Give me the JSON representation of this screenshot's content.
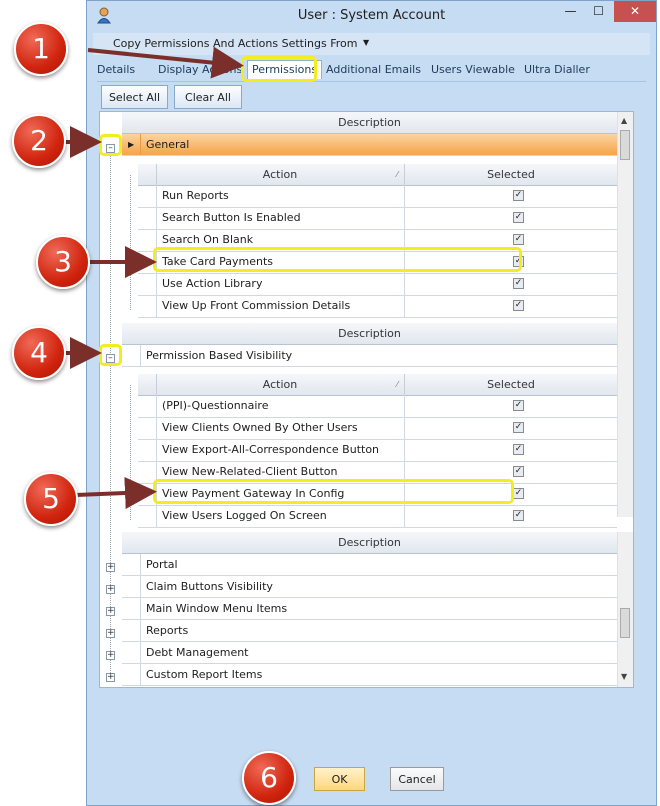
{
  "window": {
    "title": "User : System Account"
  },
  "menu": {
    "copy_settings_label": "Copy Permissions And Actions Settings From"
  },
  "tabs": [
    {
      "label": "Details"
    },
    {
      "label": "Display Actions"
    },
    {
      "label": "Permissions",
      "active": true
    },
    {
      "label": "Additional Emails"
    },
    {
      "label": "Users Viewable"
    },
    {
      "label": "Ultra Dialler"
    }
  ],
  "toolbar": {
    "select_all_label": "Select All",
    "clear_all_label": "Clear All"
  },
  "grid": {
    "column_header": "Description",
    "groups": [
      {
        "label": "General",
        "selected": true,
        "action_header": "Action",
        "selected_header": "Selected",
        "actions": [
          {
            "label": "Run Reports",
            "checked": true
          },
          {
            "label": "Search Button Is Enabled",
            "checked": true
          },
          {
            "label": "Search On Blank",
            "checked": true
          },
          {
            "label": "Take Card Payments",
            "checked": true
          },
          {
            "label": "Use Action Library",
            "checked": true
          },
          {
            "label": "View Up Front Commission Details",
            "checked": true
          }
        ]
      },
      {
        "label": "Permission Based Visibility",
        "selected": false,
        "action_header": "Action",
        "selected_header": "Selected",
        "actions": [
          {
            "label": "(PPI)-Questionnaire",
            "checked": true
          },
          {
            "label": "View Clients Owned By Other Users",
            "checked": true
          },
          {
            "label": "View Export-All-Correspondence Button",
            "checked": true
          },
          {
            "label": "View New-Related-Client Button",
            "checked": true
          },
          {
            "label": "View Payment Gateway In Config",
            "checked": true
          },
          {
            "label": "View Users Logged On Screen",
            "checked": true
          }
        ]
      }
    ],
    "collapsed_groups": [
      {
        "label": "Portal"
      },
      {
        "label": "Claim Buttons Visibility"
      },
      {
        "label": "Main Window Menu Items"
      },
      {
        "label": "Reports"
      },
      {
        "label": "Debt Management"
      },
      {
        "label": "Custom Report Items"
      }
    ]
  },
  "buttons": {
    "ok_label": "OK",
    "cancel_label": "Cancel"
  },
  "callouts": [
    {
      "number": "1"
    },
    {
      "number": "2"
    },
    {
      "number": "3"
    },
    {
      "number": "4"
    },
    {
      "number": "5"
    },
    {
      "number": "6"
    }
  ],
  "colors": {
    "marker": "#d0240e",
    "highlight": "#f1ed1e",
    "selected_row": "#f5a448",
    "arrow": "#7a2f2a",
    "window": "#c6dcf2"
  }
}
